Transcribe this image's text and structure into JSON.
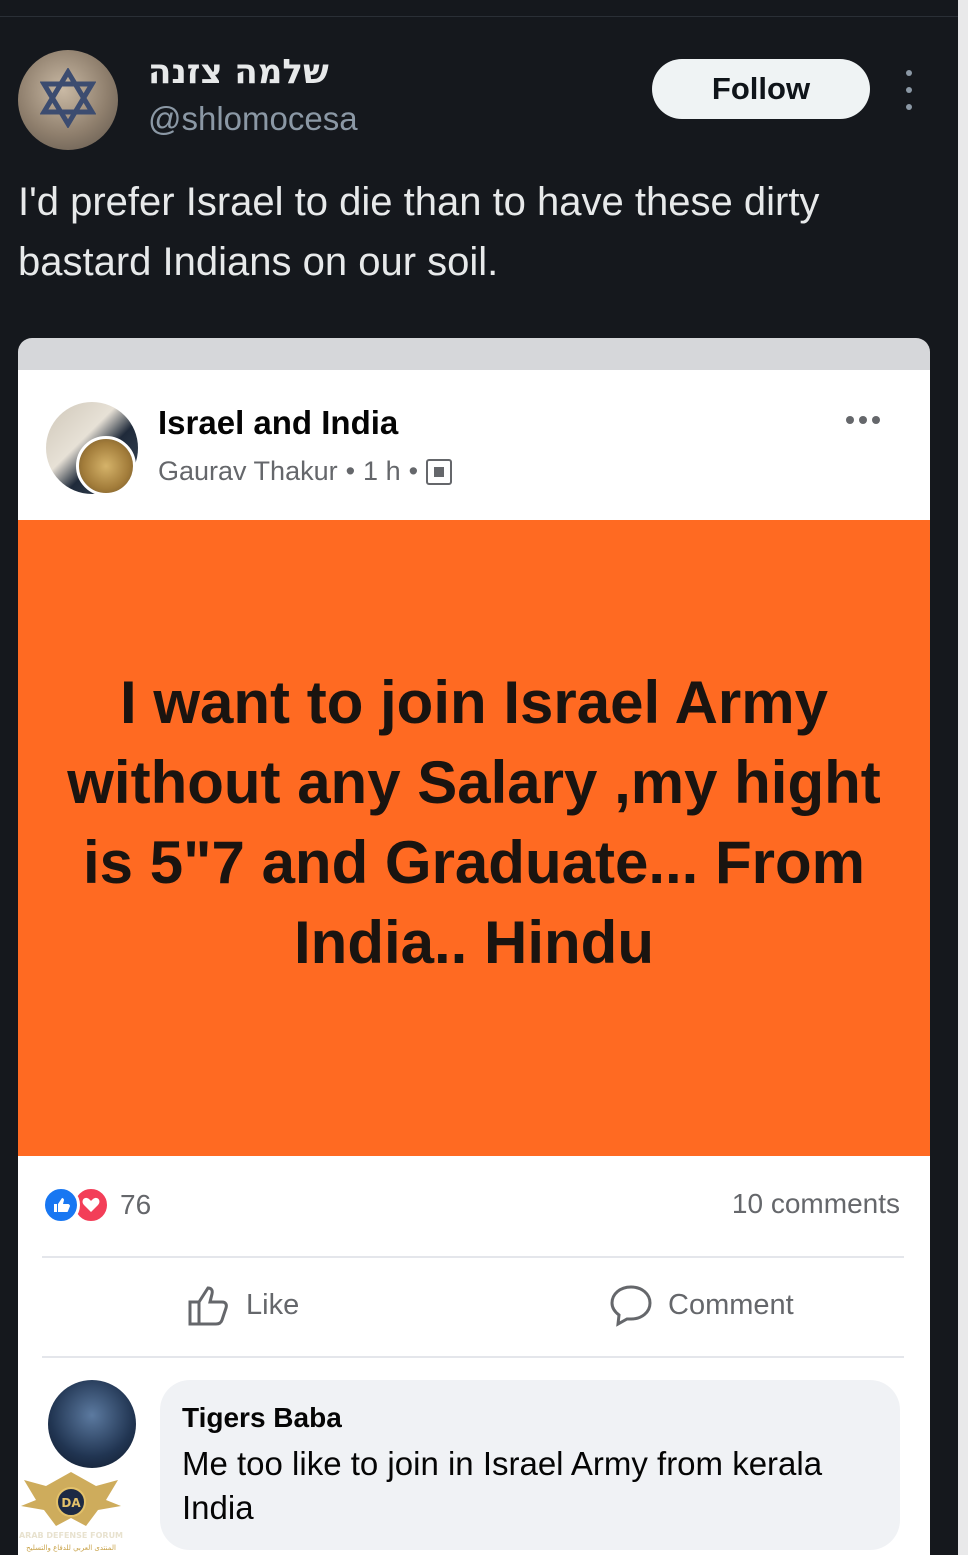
{
  "tweet": {
    "display_name": "שלמה צזנה",
    "handle": "@shlomocesa",
    "follow_label": "Follow",
    "text": "I'd prefer Israel to die than to have these dirty bastard Indians on our soil."
  },
  "fb_post": {
    "group_name": "Israel and India",
    "author": "Gaurav Thakur",
    "time": "1 h",
    "separator": "•",
    "image_text": "I want to join Israel Army without any Salary ,my hight is 5\"7 and Graduate... From India.. Hindu",
    "reaction_count": "76",
    "comments_count": "10 comments",
    "like_label": "Like",
    "comment_label": "Comment",
    "colors": {
      "panel": "#ff6a22",
      "like": "#1877f2",
      "love": "#f33e58"
    }
  },
  "comment": {
    "name": "Tigers Baba",
    "text": "Me too like to join in Israel Army from kerala India"
  },
  "watermark": {
    "line1": "ARAB DEFENSE FORUM",
    "line2": "المنتدى العربي للدفاع والتسليح"
  }
}
